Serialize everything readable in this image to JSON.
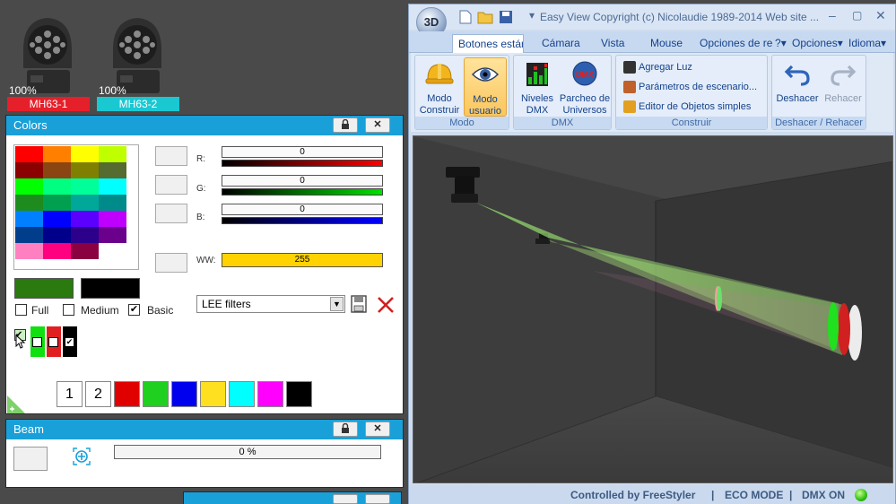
{
  "fixtures": [
    {
      "name": "MH63-1",
      "percent": "100%",
      "color": "#e5202a"
    },
    {
      "name": "MH63-2",
      "percent": "100%",
      "color": "#1ac8d2"
    }
  ],
  "colors_panel": {
    "title": "Colors",
    "lock_icon": "lock-icon",
    "close_label": "✕",
    "r_label": "R:",
    "g_label": "G:",
    "b_label": "B:",
    "ww_label": "WW:",
    "r_value": "0",
    "g_value": "0",
    "b_value": "0",
    "ww_value": "255",
    "filter_select": "LEE filters",
    "checkbox_full": "Full",
    "checkbox_medium": "Medium",
    "checkbox_basic": "Basic",
    "basic_checked": true,
    "page_1": "1",
    "page_2": "2",
    "selected_color": "#2a7a10",
    "secondary_color": "#000000",
    "palette_rows": [
      [
        "#ff0000",
        "#ff7f00",
        "#ffff00",
        "#bfff00"
      ],
      [
        "#8b0000",
        "#8b4513",
        "#808000",
        "#556b2f"
      ],
      [
        "#00ff00",
        "#00ff80",
        "#00ff99",
        "#00ffff"
      ],
      [
        "#1e8b1e",
        "#00a050",
        "#00a89a",
        "#008b8b"
      ],
      [
        "#0080ff",
        "#0000ff",
        "#5b00ff",
        "#bf00ff"
      ],
      [
        "#003e8b",
        "#00008b",
        "#2c008b",
        "#6a008b"
      ],
      [
        "#ff80c0",
        "#ff0080",
        "#8b0040",
        "#ffffff"
      ]
    ],
    "bottom_swatches": [
      "#e00000",
      "#20d020",
      "#0000ee",
      "#ffe020",
      "#00ffff",
      "#ff00ff",
      "#000000"
    ]
  },
  "beam_panel": {
    "title": "Beam",
    "value": "0 %"
  },
  "window": {
    "title": "Easy View  Copyright (c) Nicolaudie 1989-2014  Web site ...",
    "app_badge": "3D",
    "tabs": [
      "Botones estánd",
      "Cámara",
      "Vista",
      "Mouse",
      "Opciones de re"
    ],
    "right_menu": [
      "?",
      "Opciones",
      "Idioma"
    ],
    "groups": {
      "modo": {
        "label": "Modo",
        "buttons": [
          {
            "line1": "Modo",
            "line2": "Construir"
          },
          {
            "line1": "Modo",
            "line2": "usuario"
          }
        ]
      },
      "dmx": {
        "label": "DMX",
        "buttons": [
          {
            "line1": "Niveles",
            "line2": "DMX"
          },
          {
            "line1": "Parcheo de",
            "line2": "Universos"
          }
        ]
      },
      "construir": {
        "label": "Construir",
        "items": [
          "Agregar Luz",
          "Parámetros de escenario...",
          "Editor de Objetos simples"
        ]
      },
      "deshacer": {
        "label": "Deshacer / Rehacer",
        "buttons": [
          "Deshacer",
          "Rehacer"
        ]
      }
    },
    "status": {
      "controlled": "Controlled by FreeStyler",
      "sep": "|",
      "eco": "ECO MODE",
      "dmx": "DMX ON"
    }
  }
}
